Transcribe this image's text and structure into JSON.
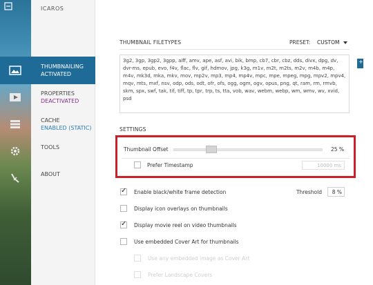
{
  "app": {
    "title": "ICAROS"
  },
  "sidebar": {
    "items": [
      {
        "label": "THUMBNAILING",
        "status": "ACTIVATED",
        "icon": "image-icon"
      },
      {
        "label": "PROPERTIES",
        "status": "DEACTIVATED",
        "icon": "video-icon"
      },
      {
        "label": "CACHE",
        "status": "ENABLED (STATIC)",
        "icon": "database-icon"
      },
      {
        "label": "TOOLS",
        "status": "",
        "icon": "gear-icon"
      },
      {
        "label": "ABOUT",
        "status": "",
        "icon": "feather-icon"
      }
    ]
  },
  "filetypes": {
    "title": "THUMBNAIL FILETYPES",
    "preset_label": "PRESET:",
    "preset_value": "CUSTOM",
    "list": "3g2, 3gp, 3gp2, 3gpp, aiff, amv, ape, asf, avi, bik, bmp, cb7, cbr, cbz, dds, divx, dpg, dv, dvr-ms, epub, evo, f4v, flac, flv, gif, hdmov, jpg, k3g, m1v, m2t, m2ts, m2v, m4b, m4p, m4v, mk3d, mka, mkv, mov, mp2v, mp3, mp4, mp4v, mpc, mpe, mpeg, mpg, mpv2, mpv4, mqv, mts, mxf, nsv, odp, ods, odt, ofr, ofs, ogg, ogm, ogv, opus, png, qt, ram, rm, rmvb, skm, spx, swf, tak, tif, tiff, tp, tpr, trp, ts, tta, vob, wav, webm, webp, wm, wmv, wv, xvid, psd"
  },
  "settings": {
    "title": "SETTINGS",
    "thumbnail_offset_label": "Thumbnail Offset",
    "thumbnail_offset_value": "25 %",
    "thumbnail_offset_fraction": 0.25,
    "prefer_timestamp_label": "Prefer Timestamp",
    "prefer_timestamp_value": "10000 ms",
    "options": [
      {
        "label": "Enable black/white frame detection",
        "checked": true
      },
      {
        "label": "Display icon overlays on thumbnails",
        "checked": false
      },
      {
        "label": "Display movie reel on video thumbnails",
        "checked": true
      },
      {
        "label": "Use embedded Cover Art for thumbnails",
        "checked": false
      }
    ],
    "sub_options": [
      {
        "label": "Use any embedded image as Cover Art",
        "checked": false
      },
      {
        "label": "Prefer Landscape Covers",
        "checked": false
      }
    ],
    "threshold_label": "Threshold",
    "threshold_value": "8 %"
  },
  "colors": {
    "accent": "#1f6b98",
    "highlight": "#c9202a",
    "deactivated": "#8a2d8e",
    "enabled": "#2b7bb3"
  }
}
